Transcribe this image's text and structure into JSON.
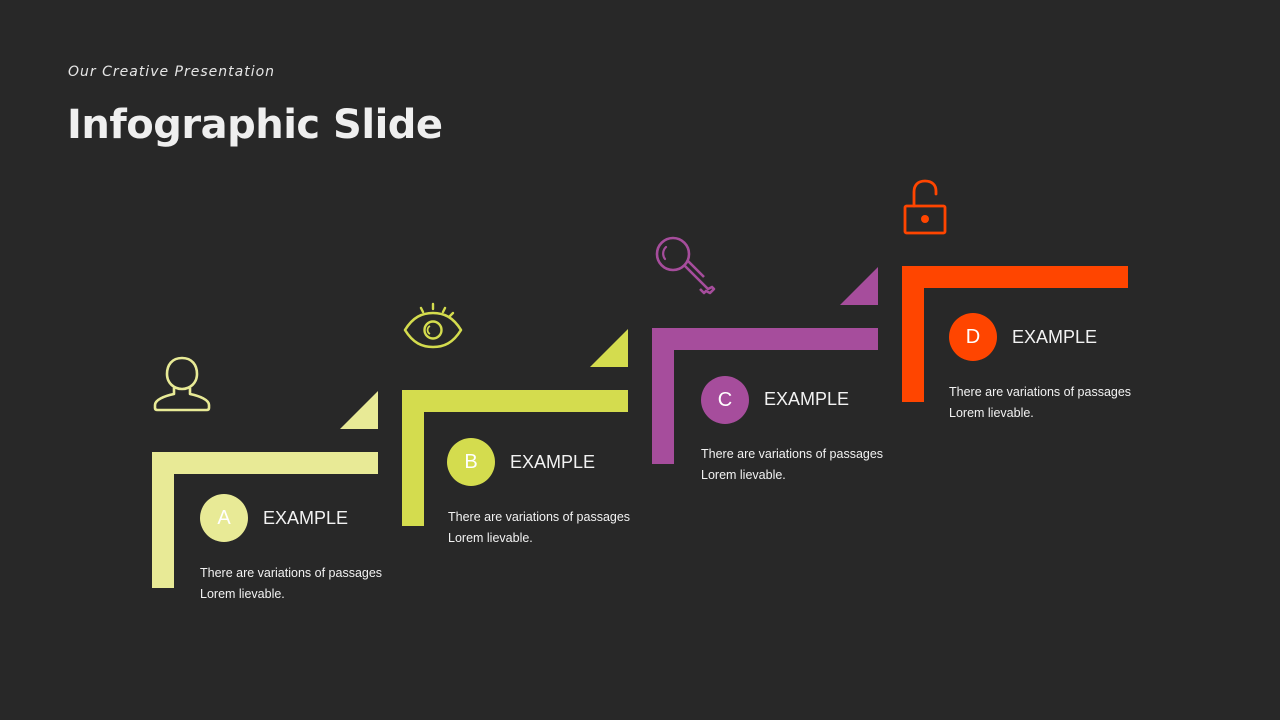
{
  "header": {
    "subtitle": "Our Creative Presentation",
    "title": "Infographic Slide"
  },
  "steps": [
    {
      "letter": "A",
      "label": "EXAMPLE",
      "desc_line1": "There are variations of passages",
      "desc_line2": "Lorem lievable.",
      "color": "#E8EA96",
      "icon": "user-icon"
    },
    {
      "letter": "B",
      "label": "EXAMPLE",
      "desc_line1": "There are variations of passages",
      "desc_line2": "Lorem lievable.",
      "color": "#D4DC4E",
      "icon": "eye-icon"
    },
    {
      "letter": "C",
      "label": "EXAMPLE",
      "desc_line1": "There are variations of passages",
      "desc_line2": "Lorem lievable.",
      "color": "#A64D9C",
      "icon": "key-icon"
    },
    {
      "letter": "D",
      "label": "EXAMPLE",
      "desc_line1": "There are variations of passages",
      "desc_line2": "Lorem lievable.",
      "color": "#FF4500",
      "icon": "unlock-icon"
    }
  ]
}
